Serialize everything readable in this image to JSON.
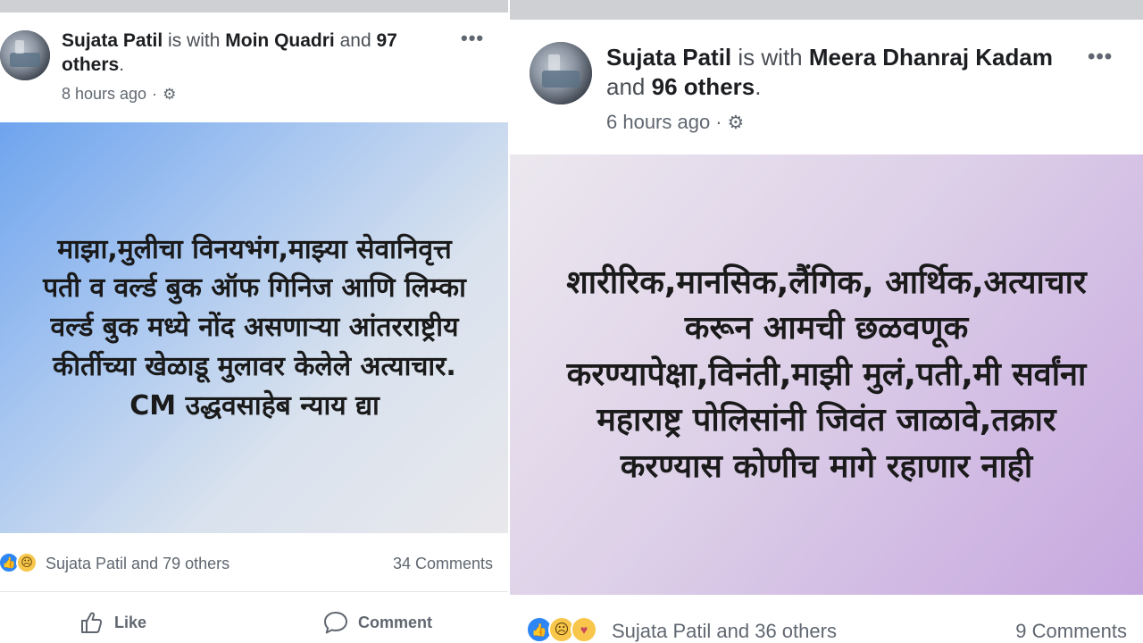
{
  "left_post": {
    "author": "Sujata Patil",
    "with_text": "is with",
    "tagged": "Moin Quadri",
    "and_text": "and",
    "others": "97 others",
    "period": ".",
    "time": "8 hours ago",
    "more_icon": "more-dots-icon",
    "privacy_icon": "gear-icon",
    "banner_text": "माझा,मुलीचा विनयभंग,माझ्या सेवानिवृत्त पती व वर्ल्ड बुक ऑफ गिनिज आणि लिम्का वर्ल्ड बुक मध्ये नोंद असणाऱ्या आंतरराष्ट्रीय कीर्तीच्या खेळाडू मुलावर केलेले अत्याचार. CM उद्धवसाहेब न्याय द्या",
    "reactions_text": "Sujata Patil and 79 others",
    "comments": "34 Comments",
    "like_label": "Like",
    "comment_label": "Comment"
  },
  "right_post": {
    "author": "Sujata Patil",
    "with_text": "is with",
    "tagged": "Meera Dhanraj Kadam",
    "and_text": "and",
    "others": "96 others",
    "period": ".",
    "time": "6 hours ago",
    "more_icon": "more-dots-icon",
    "privacy_icon": "gear-icon",
    "banner_text": "शारीरिक,मानसिक,लैंगिक, आर्थिक,अत्याचार करून आमची छळवणूक करण्यापेक्षा,विनंती,माझी मुलं,पती,मी सर्वांना महाराष्ट्र पोलिसांनी जिवंत जाळावे,तक्रार करण्यास कोणीच मागे रहाणार नाही",
    "reactions_text": "Sujata Patil and 36 others",
    "comments": "9 Comments"
  },
  "colors": {
    "text_primary": "#1c1e21",
    "text_secondary": "#606770",
    "like_blue": "#2d86f3",
    "reaction_yellow": "#f7c64a",
    "left_banner_start": "#6ea4ee",
    "right_banner_end": "#c6a7df"
  }
}
